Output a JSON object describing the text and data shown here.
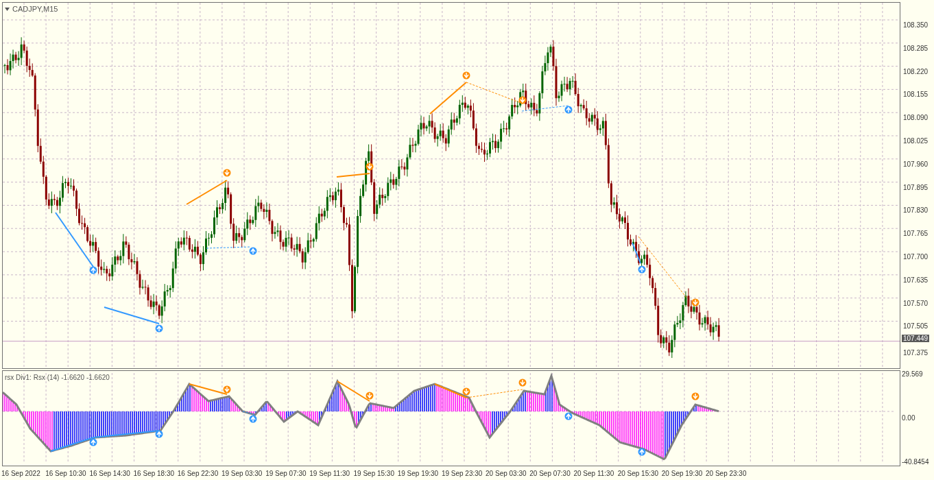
{
  "chart": {
    "title": "CADJPY,M15",
    "current_price": "107.449"
  },
  "price_axis": [
    "108.350",
    "108.285",
    "108.220",
    "108.155",
    "108.090",
    "108.025",
    "107.960",
    "107.895",
    "107.830",
    "107.765",
    "107.700",
    "107.635",
    "107.570",
    "107.505",
    "107.375"
  ],
  "indicator": {
    "label": "rsx Div1: Rsx (14) -1.6620 -1.6620",
    "axis": [
      "29.569",
      "0.00",
      "-40.8454"
    ]
  },
  "time_axis": [
    "16 Sep 2022",
    "16 Sep 10:30",
    "16 Sep 14:30",
    "16 Sep 18:30",
    "16 Sep 22:30",
    "19 Sep 03:30",
    "19 Sep 07:30",
    "19 Sep 11:30",
    "19 Sep 15:30",
    "19 Sep 19:30",
    "19 Sep 23:30",
    "20 Sep 03:30",
    "20 Sep 07:30",
    "20 Sep 11:30",
    "20 Sep 15:30",
    "20 Sep 19:30",
    "20 Sep 23:30"
  ]
}
